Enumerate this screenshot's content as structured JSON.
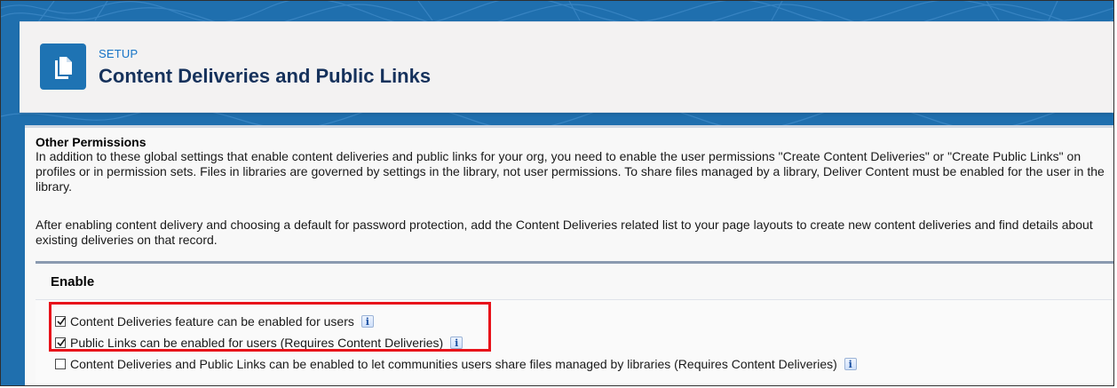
{
  "header": {
    "eyebrow": "SETUP",
    "title": "Content Deliveries and Public Links"
  },
  "permissions": {
    "heading": "Other Permissions",
    "paragraph1": "In addition to these global settings that enable content deliveries and public links for your org, you need to enable the user permissions \"Create Content Deliveries\" or \"Create Public Links\" on profiles or in permission sets. Files in libraries are governed by settings in the library, not user permissions. To share files managed by a library, Deliver Content must be enabled for the user in the library.",
    "paragraph2": "After enabling content delivery and choosing a default for password protection, add the Content Deliveries related list to your page layouts to create new content deliveries and find details about existing deliveries on that record."
  },
  "enable": {
    "title": "Enable",
    "options": [
      {
        "label": "Content Deliveries feature can be enabled for users",
        "checked": true,
        "info_glyph": "i"
      },
      {
        "label": "Public Links can be enabled for users (Requires Content Deliveries)",
        "checked": true,
        "info_glyph": "i"
      },
      {
        "label": "Content Deliveries and Public Links can be enabled to let communities users share files managed by libraries (Requires Content Deliveries)",
        "checked": false,
        "info_glyph": "i"
      }
    ]
  },
  "colors": {
    "brand_blue": "#1e73b3",
    "link_blue": "#1674c7",
    "title_navy": "#16325c",
    "highlight_red": "#e8121a"
  },
  "icons": {
    "page_icon": "document-copy-icon",
    "info_icon": "info-icon",
    "checkbox_icon": "checkmark-icon"
  }
}
